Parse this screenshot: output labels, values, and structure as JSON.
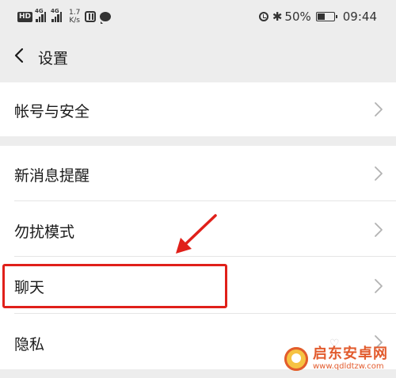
{
  "status_bar": {
    "hd_badge": "HD",
    "signal1_tag": "4G",
    "signal2_tag": "4G",
    "speed_value": "1.7",
    "speed_unit": "K/s",
    "battery_percent": "50%",
    "battery_level": 0.5,
    "time": "09:44"
  },
  "nav": {
    "title": "设置"
  },
  "settings": {
    "account_security": "帐号与安全",
    "new_message_alert": "新消息提醒",
    "do_not_disturb": "勿扰模式",
    "chat": "聊天",
    "privacy": "隐私"
  },
  "watermark": {
    "brand": "启东安卓网",
    "url": "www.qdldtzw.com"
  },
  "colors": {
    "background": "#ededed",
    "row_background": "#ffffff",
    "annotation_red": "#e0201a",
    "watermark_orange": "#e25b2d"
  }
}
